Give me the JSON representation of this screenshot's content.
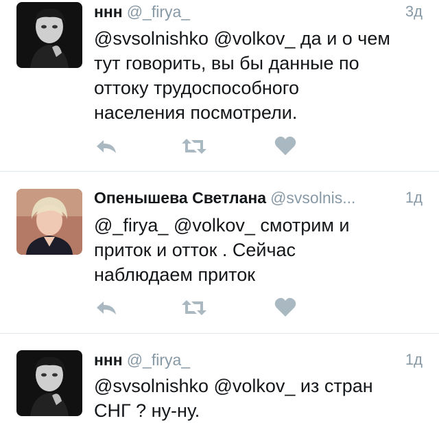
{
  "tweets": [
    {
      "author_name": "ннн",
      "author_handle": "@_firya_",
      "time": "3д",
      "text": "@svsolnishko @volkov_ да и о чем\nтут говорить,  вы бы данные по\nоттоку трудоспособного\nнаселения посмотрели."
    },
    {
      "author_name": "Опенышева Светлана",
      "author_handle": "@svsolnis...",
      "time": "1д",
      "text": "@_firya_ @volkov_ смотрим и\nприток и отток . Сейчас\nнаблюдаем приток"
    },
    {
      "author_name": "ннн",
      "author_handle": "@_firya_",
      "time": "1д",
      "text": "@svsolnishko @volkov_ из стран\nСНГ ? ну-ну."
    }
  ],
  "icons": {
    "reply": "reply-icon",
    "retweet": "retweet-icon",
    "like": "heart-icon"
  },
  "colors": {
    "icon_gray": "#aab8c2",
    "meta_gray": "#8899a6",
    "divider": "#e1e8ed"
  }
}
